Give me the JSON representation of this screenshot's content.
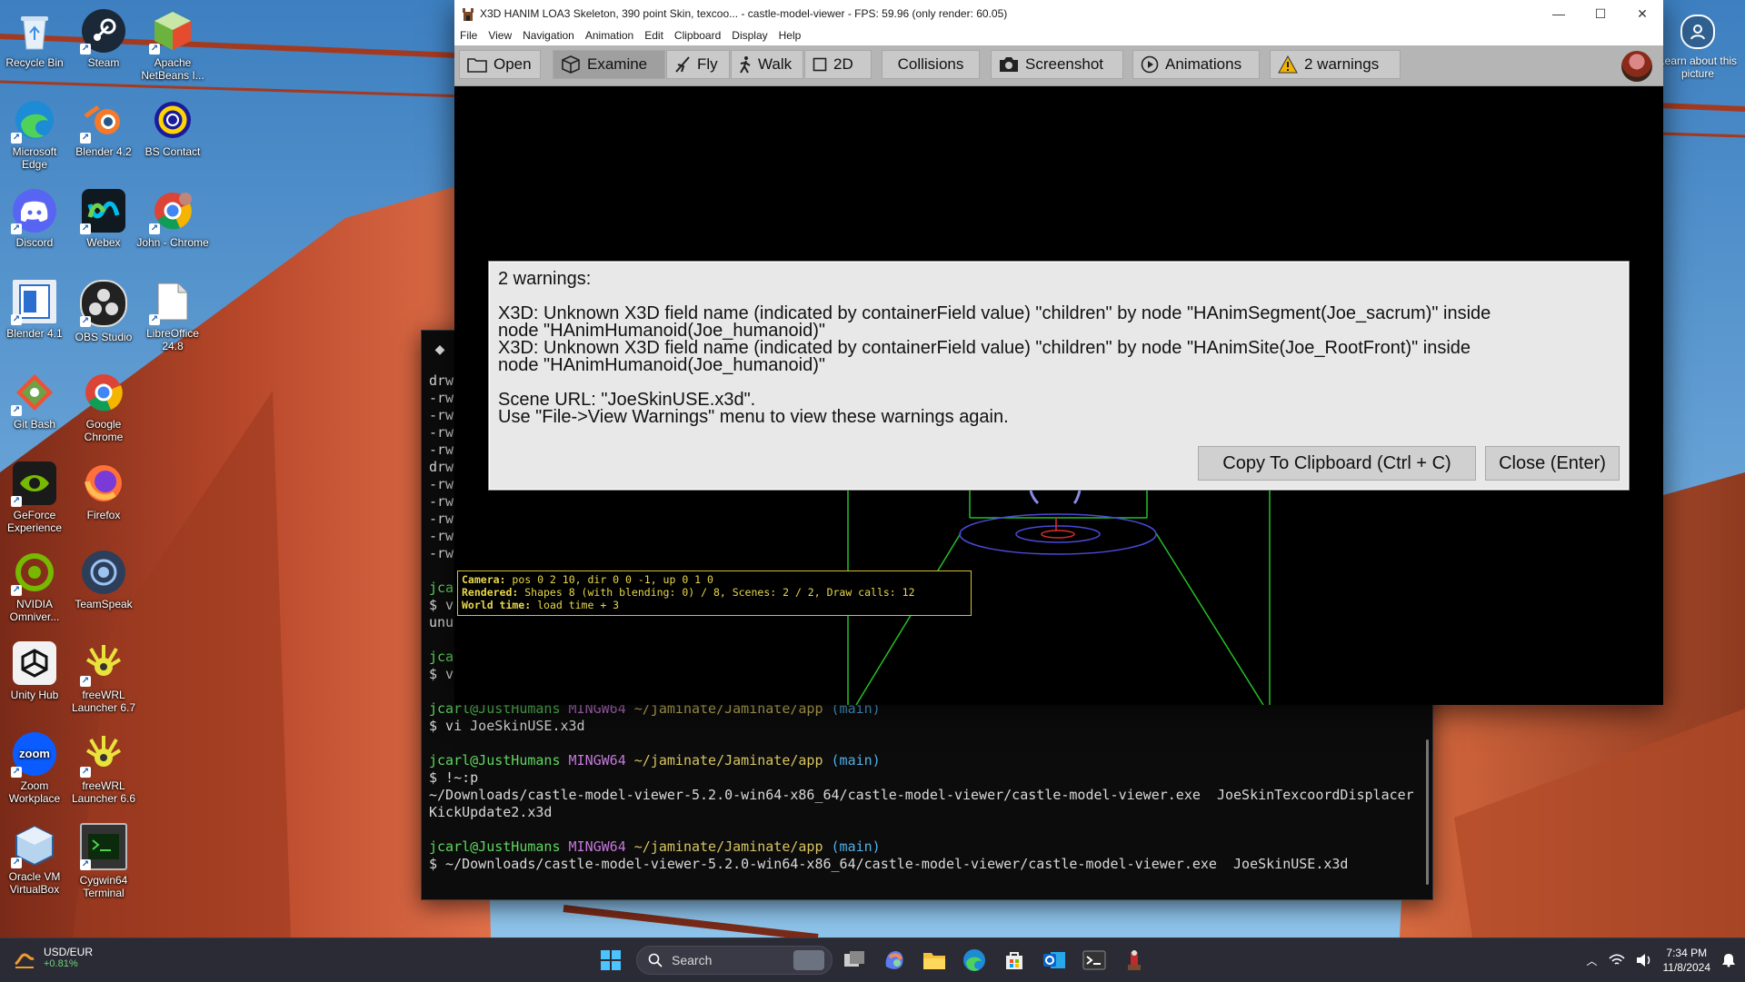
{
  "desktop": {
    "icons": [
      {
        "label": "Recycle Bin"
      },
      {
        "label": "Steam"
      },
      {
        "label": "Apache NetBeans I..."
      },
      {
        "label": "Microsoft Edge"
      },
      {
        "label": "Blender 4.2"
      },
      {
        "label": "BS Contact"
      },
      {
        "label": "Discord"
      },
      {
        "label": "Webex"
      },
      {
        "label": "John - Chrome"
      },
      {
        "label": "Blender 4.1"
      },
      {
        "label": "OBS Studio"
      },
      {
        "label": "LibreOffice 24.8"
      },
      {
        "label": "Git Bash"
      },
      {
        "label": "Google Chrome"
      },
      {
        "label": "GeForce Experience"
      },
      {
        "label": "Firefox"
      },
      {
        "label": "NVIDIA Omniver..."
      },
      {
        "label": "TeamSpeak"
      },
      {
        "label": "Unity Hub"
      },
      {
        "label": "freeWRL Launcher 6.7"
      },
      {
        "label": "Zoom Workplace"
      },
      {
        "label": "freeWRL Launcher 6.6"
      },
      {
        "label": "Oracle VM VirtualBox"
      },
      {
        "label": "Cygwin64 Terminal"
      }
    ],
    "learn_about": "Learn about this picture"
  },
  "viewer": {
    "title": "X3D HANIM LOA3 Skeleton, 390 point Skin, texcoo... - castle-model-viewer - FPS: 59.96 (only render: 60.05)",
    "menu": [
      "File",
      "View",
      "Navigation",
      "Animation",
      "Edit",
      "Clipboard",
      "Display",
      "Help"
    ],
    "toolbar": {
      "open": "Open",
      "examine": "Examine",
      "fly": "Fly",
      "walk": "Walk",
      "two_d": "2D",
      "collisions": "Collisions",
      "screenshot": "Screenshot",
      "animations": "Animations",
      "warnings": "2 warnings"
    },
    "info": {
      "camera_label": "Camera:",
      "camera": " pos 0 2 10, dir 0 0 -1, up 0 1 0",
      "rendered_label": "Rendered:",
      "rendered": " Shapes 8 (with blending: 0) / 8, Scenes: 2 / 2, Draw calls: 12",
      "world_label": "World time:",
      "world": " load time + 3"
    },
    "dialog": {
      "heading": "2 warnings:",
      "warning1_line1": "X3D: Unknown X3D field name (indicated by containerField value) \"children\" by node \"HAnimSegment(Joe_sacrum)\" inside",
      "warning1_line2": "node \"HAnimHumanoid(Joe_humanoid)\"",
      "warning2_line1": "X3D: Unknown X3D field name (indicated by containerField value) \"children\" by node \"HAnimSite(Joe_RootFront)\" inside",
      "warning2_line2": "node \"HAnimHumanoid(Joe_humanoid)\"",
      "scene_url": "Scene URL: \"JoeSkinUSE.x3d\".",
      "hint": "Use \"File->View Warnings\" menu to view these warnings again.",
      "copy_button": "Copy To Clipboard (Ctrl + C)",
      "close_button": "Close (Enter)"
    }
  },
  "terminal": {
    "listing_prefixes": [
      "drw",
      "-rw",
      "-rw",
      "-rw",
      "-rw",
      "drw",
      "-rw",
      "-rw",
      "-rw",
      "-rw",
      "-rw"
    ],
    "fragments": {
      "user1": "jca",
      "cmd1": "$ v",
      "out1": "unu",
      "user2": "jca",
      "cmd2": "$ v"
    },
    "user_host": "jcarl@JustHumans",
    "shell": "MINGW64",
    "path": "~/jaminate/Jaminate/app",
    "branch": "(main)",
    "cmd_vi": "$ vi JoeSkinUSE.x3d",
    "cmd_hist": "$ !~:p",
    "hist_out1": "~/Downloads/castle-model-viewer-5.2.0-win64-x86_64/castle-model-viewer/castle-model-viewer.exe  JoeSkinTexcoordDisplacer",
    "hist_out2": "KickUpdate2.x3d",
    "cmd_run": "$ ~/Downloads/castle-model-viewer-5.2.0-win64-x86_64/castle-model-viewer/castle-model-viewer.exe  JoeSkinUSE.x3d"
  },
  "taskbar": {
    "widget_label": "USD/EUR",
    "widget_change": "+0.81%",
    "search_placeholder": "Search",
    "time": "7:34 PM",
    "date": "11/8/2024"
  }
}
